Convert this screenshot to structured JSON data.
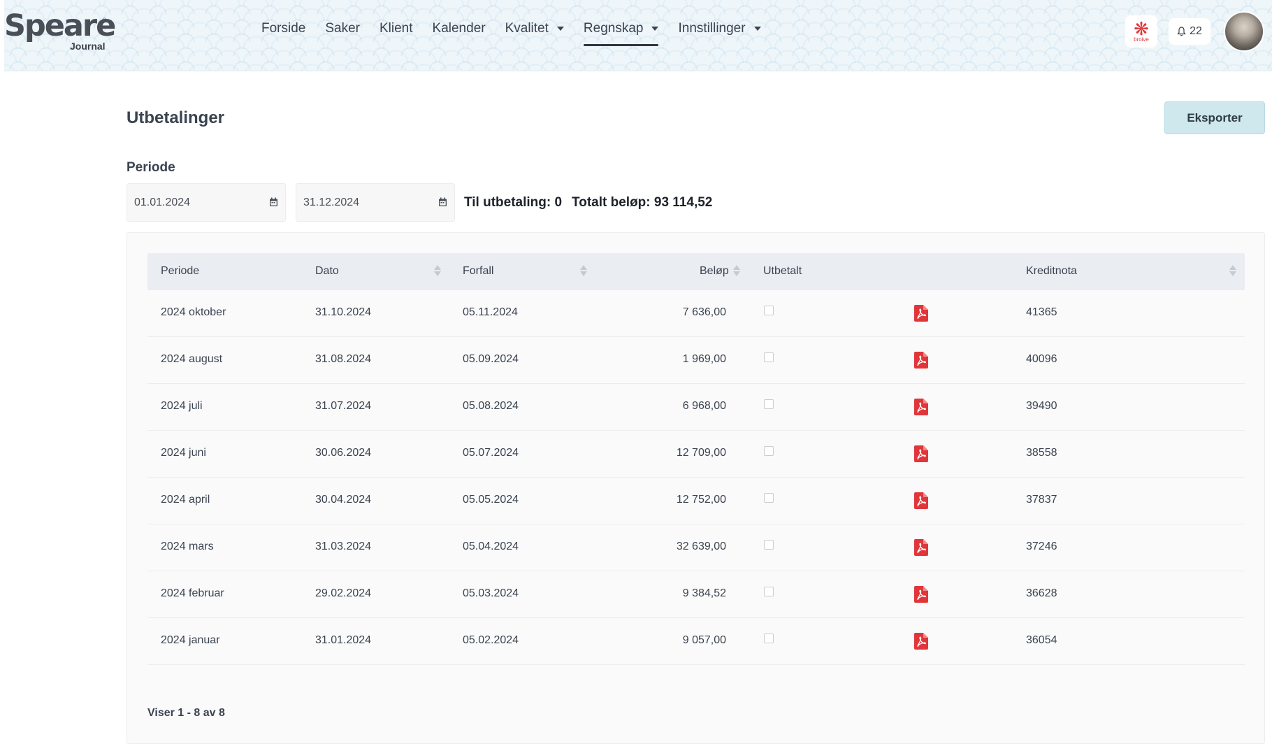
{
  "brand": {
    "logo_text": "Speare",
    "logo_sub": "Journal",
    "partner_text": "broive"
  },
  "nav": {
    "items": [
      {
        "label": "Forside",
        "dropdown": false,
        "active": false
      },
      {
        "label": "Saker",
        "dropdown": false,
        "active": false
      },
      {
        "label": "Klient",
        "dropdown": false,
        "active": false
      },
      {
        "label": "Kalender",
        "dropdown": false,
        "active": false
      },
      {
        "label": "Kvalitet",
        "dropdown": true,
        "active": false
      },
      {
        "label": "Regnskap",
        "dropdown": true,
        "active": true
      },
      {
        "label": "Innstillinger",
        "dropdown": true,
        "active": false
      }
    ]
  },
  "notifications": {
    "count": "22",
    "icon": "bell-icon"
  },
  "page": {
    "title": "Utbetalinger",
    "export_label": "Eksporter",
    "period_label": "Periode",
    "date_from": "01.01.2024",
    "date_to": "31.12.2024",
    "to_pay": "Til utbetaling: 0",
    "total": "Totalt beløp: 93 114,52"
  },
  "table": {
    "columns": [
      "Periode",
      "Dato",
      "Forfall",
      "Beløp",
      "Utbetalt",
      "Kreditnota"
    ],
    "rows": [
      {
        "periode": "2024 oktober",
        "dato": "31.10.2024",
        "forfall": "05.11.2024",
        "belop": "7 636,00",
        "utbetalt": false,
        "kreditnota": "41365"
      },
      {
        "periode": "2024 august",
        "dato": "31.08.2024",
        "forfall": "05.09.2024",
        "belop": "1 969,00",
        "utbetalt": false,
        "kreditnota": "40096"
      },
      {
        "periode": "2024 juli",
        "dato": "31.07.2024",
        "forfall": "05.08.2024",
        "belop": "6 968,00",
        "utbetalt": false,
        "kreditnota": "39490"
      },
      {
        "periode": "2024 juni",
        "dato": "30.06.2024",
        "forfall": "05.07.2024",
        "belop": "12 709,00",
        "utbetalt": false,
        "kreditnota": "38558"
      },
      {
        "periode": "2024 april",
        "dato": "30.04.2024",
        "forfall": "05.05.2024",
        "belop": "12 752,00",
        "utbetalt": false,
        "kreditnota": "37837"
      },
      {
        "periode": "2024 mars",
        "dato": "31.03.2024",
        "forfall": "05.04.2024",
        "belop": "32 639,00",
        "utbetalt": false,
        "kreditnota": "37246"
      },
      {
        "periode": "2024 februar",
        "dato": "29.02.2024",
        "forfall": "05.03.2024",
        "belop": "9 384,52",
        "utbetalt": false,
        "kreditnota": "36628"
      },
      {
        "periode": "2024 januar",
        "dato": "31.01.2024",
        "forfall": "05.02.2024",
        "belop": "9 057,00",
        "utbetalt": false,
        "kreditnota": "36054"
      }
    ],
    "footer": "Viser 1 - 8 av 8"
  },
  "colors": {
    "accent": "#cfe8ee",
    "pdf_red": "#e0363a",
    "header_bg": "#eef6fa"
  }
}
